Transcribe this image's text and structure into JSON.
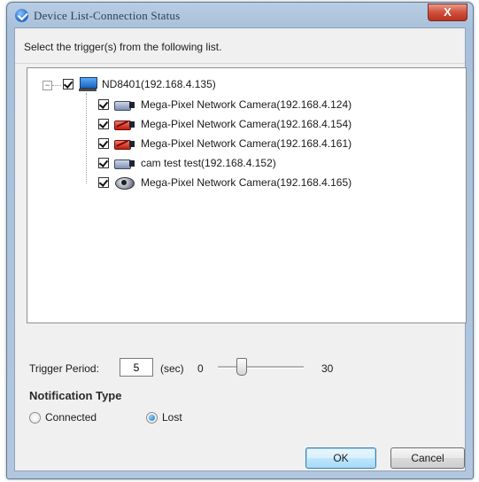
{
  "window": {
    "title": "Device List-Connection Status",
    "close_label": "X"
  },
  "instruction": "Select the trigger(s) from the following list.",
  "tree": {
    "root": {
      "label": "ND8401(192.168.4.135)",
      "checked": true,
      "expanded": true,
      "expander_symbol": "−",
      "icon": "computer-icon"
    },
    "children": [
      {
        "label": "Mega-Pixel Network Camera(192.168.4.124)",
        "checked": true,
        "icon": "camera-connected-icon"
      },
      {
        "label": "Mega-Pixel Network Camera(192.168.4.154)",
        "checked": true,
        "icon": "camera-disconnected-icon"
      },
      {
        "label": "Mega-Pixel Network Camera(192.168.4.161)",
        "checked": true,
        "icon": "camera-disconnected-icon"
      },
      {
        "label": "cam test test(192.168.4.152)",
        "checked": true,
        "icon": "camera-connected-icon"
      },
      {
        "label": "Mega-Pixel Network Camera(192.168.4.165)",
        "checked": true,
        "icon": "dome-camera-icon"
      }
    ]
  },
  "trigger_period": {
    "label": "Trigger Period:",
    "value": "5",
    "unit": "(sec)",
    "min_label": "0",
    "max_label": "30",
    "slider_value": 5
  },
  "notification": {
    "heading": "Notification Type",
    "options": [
      {
        "label": "Connected",
        "selected": false
      },
      {
        "label": "Lost",
        "selected": true
      }
    ]
  },
  "buttons": {
    "ok": "OK",
    "cancel": "Cancel"
  },
  "colors": {
    "accent": "#3c7fb1",
    "disconnected": "#c01c10",
    "close_button": "#c8412c"
  }
}
